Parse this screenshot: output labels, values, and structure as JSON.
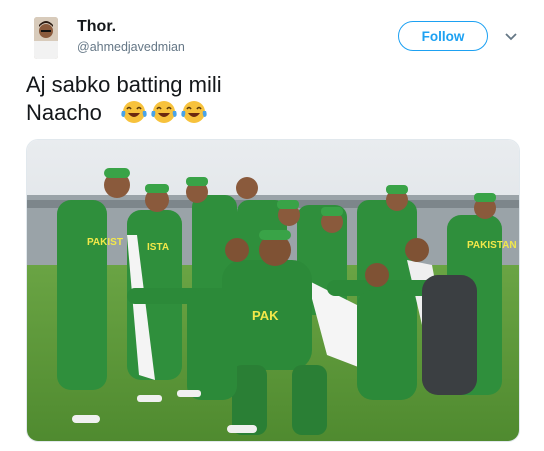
{
  "tweet": {
    "display_name": "Thor.",
    "handle": "@ahmedjavedmian",
    "follow_label": "Follow",
    "text_line1": "Aj sabko batting mili",
    "text_line2": "Naacho",
    "emoji": [
      "face-with-tears-of-joy",
      "face-with-tears-of-joy",
      "face-with-tears-of-joy"
    ],
    "image_jersey_text": [
      "PAKISTAN",
      "ISTA",
      "PAKIST",
      "PAK"
    ]
  },
  "colors": {
    "accent": "#1da1f2",
    "jersey_green": "#2e8b3a",
    "grass": "#5f9a3d"
  }
}
